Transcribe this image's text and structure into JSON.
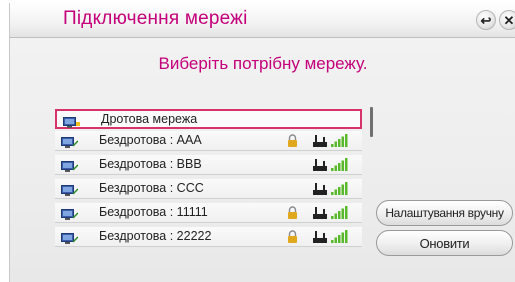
{
  "window": {
    "title": "Підключення мережі"
  },
  "header": {
    "instruction": "Виберіть потрібну мережу."
  },
  "title_buttons": {
    "back": "↩",
    "close": "✕"
  },
  "networks": [
    {
      "name": "Дротова мережа",
      "type": "wired",
      "selected": true,
      "locked": false,
      "router": false,
      "signal": null
    },
    {
      "name": "Бездротова : AAA",
      "type": "wireless",
      "selected": false,
      "locked": true,
      "router": true,
      "signal": 5
    },
    {
      "name": "Бездротова : BBB",
      "type": "wireless",
      "selected": false,
      "locked": false,
      "router": true,
      "signal": 5
    },
    {
      "name": "Бездротова : CCC",
      "type": "wireless",
      "selected": false,
      "locked": false,
      "router": true,
      "signal": 5
    },
    {
      "name": "Бездротова : 11111",
      "type": "wireless",
      "selected": false,
      "locked": true,
      "router": true,
      "signal": 5
    },
    {
      "name": "Бездротова : 22222",
      "type": "wireless",
      "selected": false,
      "locked": true,
      "router": true,
      "signal": 5
    }
  ],
  "buttons": {
    "manual": "Налаштування вручну",
    "refresh": "Оновити"
  },
  "colors": {
    "accent": "#c4007a",
    "selection": "#d7326b",
    "signal": "#5ab82d",
    "lock": "#e0a81c"
  }
}
